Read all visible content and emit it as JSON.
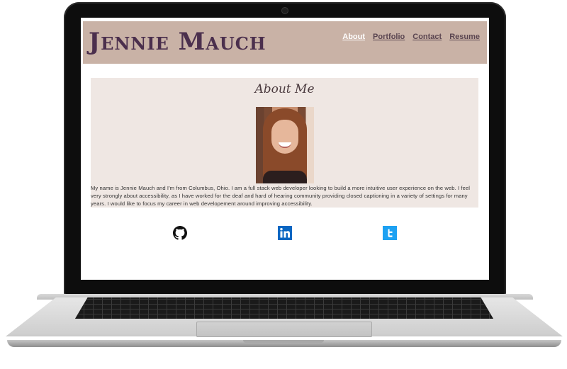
{
  "site": {
    "title": "Jennie Mauch",
    "nav": [
      {
        "label": "About",
        "active": true
      },
      {
        "label": "Portfolio",
        "active": false
      },
      {
        "label": "Contact",
        "active": false
      },
      {
        "label": "Resume",
        "active": false
      }
    ]
  },
  "about": {
    "heading": "About Me",
    "photo_alt": "profile-photo",
    "bio": "My name is Jennie Mauch and I'm from Columbus, Ohio. I am a full stack web developer looking to build a more intuitive user experience on the web. I feel very strongly about accessibility, as I have worked for the deaf and hard of hearing community providing closed captioning in a variety of settings for many years. I would like to focus my career in web developement around improving accessibility."
  },
  "social": [
    {
      "icon": "github-icon"
    },
    {
      "icon": "linkedin-icon"
    },
    {
      "icon": "twitter-icon"
    }
  ],
  "colors": {
    "header_bg": "#c9b2a6",
    "title": "#4b2f4d",
    "nav_active": "#ffffff",
    "nav": "#5a4550",
    "about_bg": "#efe7e3",
    "linkedin": "#0a66c2",
    "twitter": "#1da1f2"
  }
}
